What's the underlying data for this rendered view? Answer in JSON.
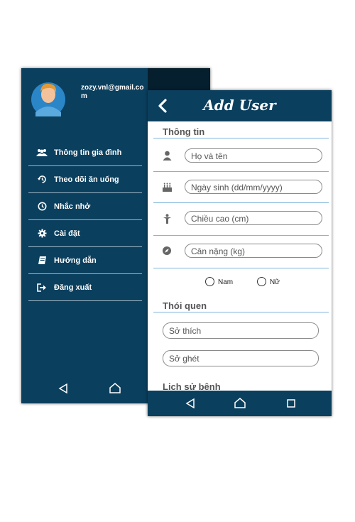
{
  "drawer": {
    "email": "zozy.vnl@gmail.com",
    "items": [
      {
        "label": "Thông tin gia đình",
        "icon": "family-icon"
      },
      {
        "label": "Theo dõi ăn uống",
        "icon": "history-icon"
      },
      {
        "label": "Nhắc nhở",
        "icon": "clock-icon"
      },
      {
        "label": "Cài đặt",
        "icon": "gear-icon"
      },
      {
        "label": "Hướng dẫn",
        "icon": "book-icon"
      },
      {
        "label": "Đăng xuất",
        "icon": "logout-icon"
      }
    ]
  },
  "form": {
    "title": "Add User",
    "section_info": "Thông tin",
    "fields": [
      {
        "placeholder": "Họ và tên",
        "icon": "person-icon"
      },
      {
        "placeholder": "Ngày sinh (dd/mm/yyyy)",
        "icon": "cake-icon"
      },
      {
        "placeholder": "Chiều cao (cm)",
        "icon": "height-icon"
      },
      {
        "placeholder": "Cân nặng (kg)",
        "icon": "compass-icon"
      }
    ],
    "gender": {
      "male": "Nam",
      "female": "Nữ"
    },
    "section_habits": "Thói quen",
    "habit_fields": [
      "Sở thích",
      "Sở ghét"
    ],
    "section_history": "Lịch sử bệnh"
  },
  "colors": {
    "primary": "#0b3f5e",
    "accent_rule": "#7fb6dd"
  }
}
